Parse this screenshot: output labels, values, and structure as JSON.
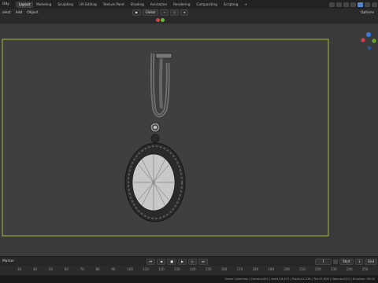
{
  "app": {
    "mode_label": "Ody"
  },
  "workspace_tabs": [
    "Layout",
    "Modeling",
    "Sculpting",
    "UV Editing",
    "Texture Paint",
    "Shading",
    "Animation",
    "Rendering",
    "Compositing",
    "Scripting",
    "+"
  ],
  "active_tab": 0,
  "header_menu": [
    "elect",
    "Add",
    "Object"
  ],
  "transform_orientation": "Global",
  "options_label": "Options",
  "timeline": {
    "marker_label": "Marker",
    "current_frame": "1",
    "start_label": "Start",
    "start_value": "1",
    "end_label": "End"
  },
  "ruler_ticks": [
    "30",
    "40",
    "50",
    "60",
    "70",
    "80",
    "90",
    "100",
    "110",
    "120",
    "130",
    "140",
    "150",
    "160",
    "170",
    "180",
    "190",
    "200",
    "210",
    "220",
    "230",
    "240",
    "250"
  ],
  "status_text": "Scene Collection | Camera.001 | Verts:16,472 | Faces:21,218 | Tris:37,830 | Objects:0/13 | Duration: 00:00",
  "colors": {
    "camera_frame": "#a8b83a",
    "viewport_bg": "#3a3a3a",
    "model_wire": "#1b1b1b"
  },
  "icons": [
    "transform-pivot-icon",
    "snap-icon",
    "proportional-icon",
    "gizmo-axis-icon",
    "play-icon",
    "rewind-icon",
    "stop-icon",
    "next-keyframe-icon",
    "jump-end-icon"
  ]
}
